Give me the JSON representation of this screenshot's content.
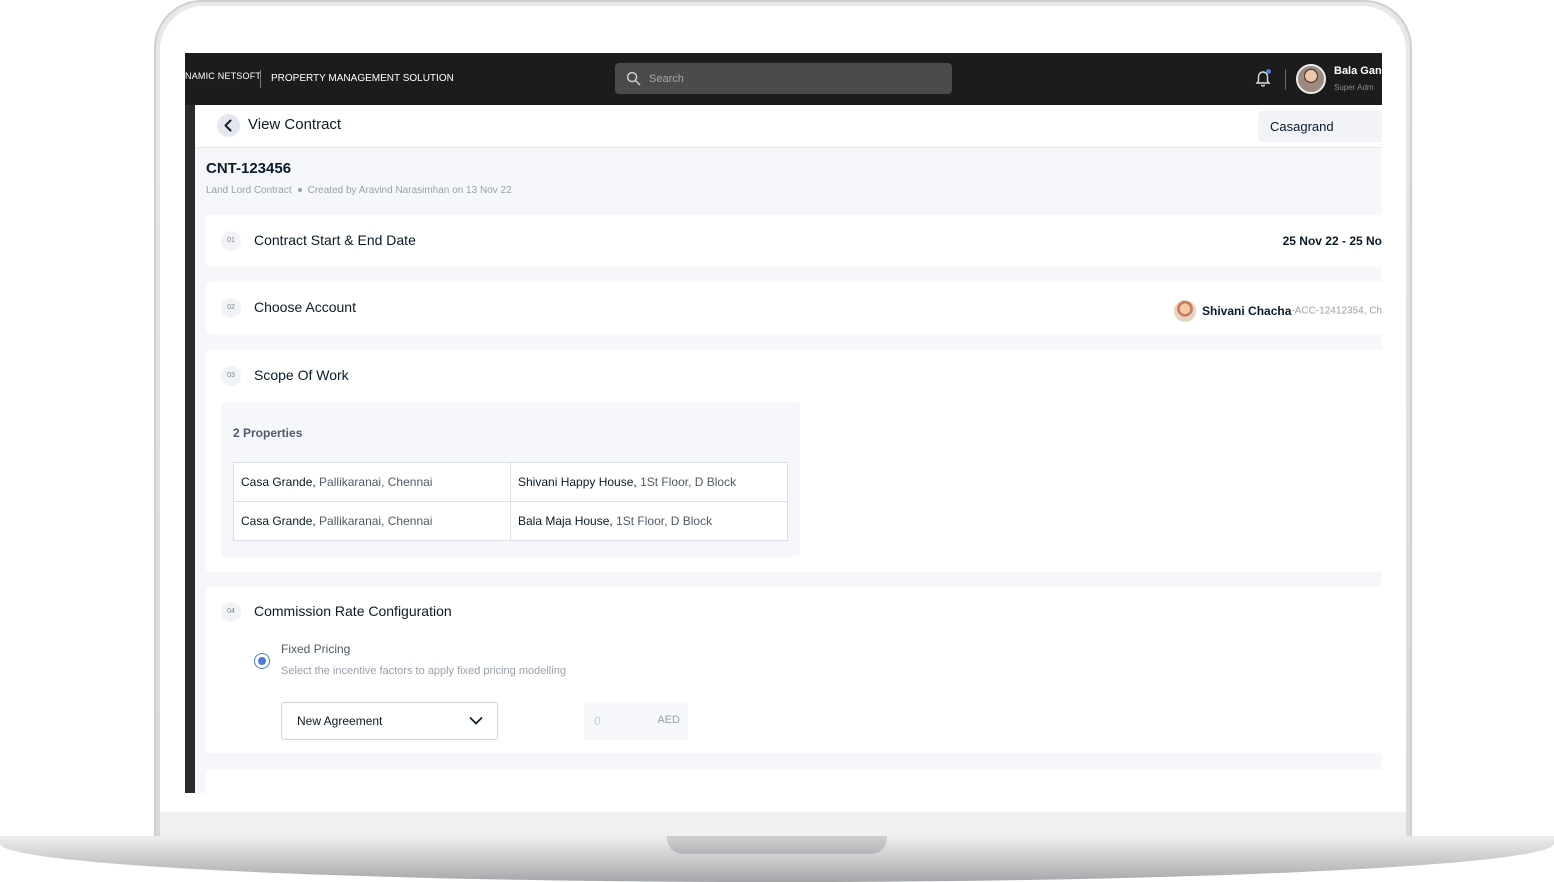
{
  "header": {
    "logo_text": "NAMIC NETSOFT",
    "product_name": "PROPERTY MANAGEMENT SOLUTION",
    "search_placeholder": "Search",
    "user_name": "Bala Gan",
    "user_role": "Super Adm"
  },
  "subheader": {
    "title": "View Contract",
    "company": "Casagrand"
  },
  "contract": {
    "id": "CNT-123456",
    "type": "Land Lord Contract",
    "created_by": "Created by Aravind Narasimhan on 13 Nov 22"
  },
  "steps": [
    {
      "number": "01",
      "title": "Contract Start & End Date",
      "value": "25 Nov 22 - 25 No"
    },
    {
      "number": "02",
      "title": "Choose Account",
      "account_name": "Shivani Chacha",
      "account_code": "-ACC-12412354, Ch"
    },
    {
      "number": "03",
      "title": "Scope Of Work"
    },
    {
      "number": "04",
      "title": "Commission Rate Configuration"
    }
  ],
  "scope": {
    "count_label": "2 Properties",
    "properties": [
      [
        {
          "name": "Casa Grande,",
          "detail": " Pallikaranai, Chennai"
        },
        {
          "name": "Shivani Happy House,",
          "detail": " 1St Floor, D Block"
        }
      ],
      [
        {
          "name": "Casa Grande,",
          "detail": " Pallikaranai, Chennai"
        },
        {
          "name": "Bala Maja House,",
          "detail": " 1St Floor, D Block"
        }
      ]
    ]
  },
  "commission": {
    "option_label": "Fixed Pricing",
    "option_desc": "Select the incentive factors to apply fixed pricing modelling",
    "agreement_value": "New Agreement",
    "amount_placeholder": "0",
    "currency": "AED"
  },
  "colors": {
    "topbar": "#1c1c1c",
    "accent": "#5078e1"
  }
}
